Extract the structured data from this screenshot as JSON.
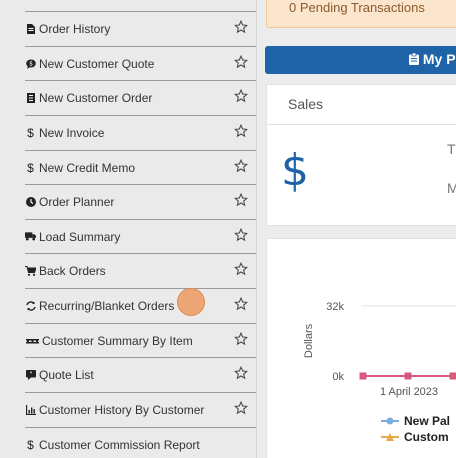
{
  "sidebar": {
    "items": [
      {
        "label": "Order History",
        "icon": "document-icon"
      },
      {
        "label": "New Customer Quote",
        "icon": "speech-bubble-icon"
      },
      {
        "label": "New Customer Order",
        "icon": "order-book-icon"
      },
      {
        "label": "New Invoice",
        "icon": "dollar-icon"
      },
      {
        "label": "New Credit Memo",
        "icon": "dollar-icon"
      },
      {
        "label": "Order Planner",
        "icon": "clock-icon"
      },
      {
        "label": "Load Summary",
        "icon": "truck-icon"
      },
      {
        "label": "Back Orders",
        "icon": "cart-icon"
      },
      {
        "label": "Recurring/Blanket Orders",
        "icon": "refresh-icon"
      },
      {
        "label": "Customer Summary By Item",
        "icon": "pallet-icon"
      },
      {
        "label": "Quote List",
        "icon": "quote-icon"
      },
      {
        "label": "Customer History By Customer",
        "icon": "line-chart-icon"
      },
      {
        "label": "Customer Commission Report",
        "icon": "dollar-icon"
      }
    ]
  },
  "pending": {
    "text": "0 Pending Transactions"
  },
  "my_button": {
    "label": "My P",
    "icon": "clipboard-icon"
  },
  "sales": {
    "title": "Sales",
    "symbol": "$",
    "t_label": "T",
    "m_label": "M"
  },
  "chart_data": {
    "type": "line",
    "ylabel": "Dollars",
    "y_ticks": [
      "32k",
      "0k"
    ],
    "ylim": [
      0,
      32000
    ],
    "x_tick_labels": [
      "1 April 2023"
    ],
    "series": [
      {
        "name": "New Pal",
        "color": "#7aaee0",
        "marker": "circle",
        "values": [
          300,
          200,
          250
        ]
      },
      {
        "name": "Custom",
        "color": "#e8a84c",
        "marker": "triangle",
        "values": [
          0,
          0,
          0
        ]
      },
      {
        "name": "",
        "color": "#d65a7e",
        "marker": "square",
        "values": [
          0,
          0,
          0
        ]
      }
    ]
  },
  "colors": {
    "accent": "#1e62a8",
    "pending_bg": "#fbe6cd",
    "series_pink": "#d65a7e"
  }
}
